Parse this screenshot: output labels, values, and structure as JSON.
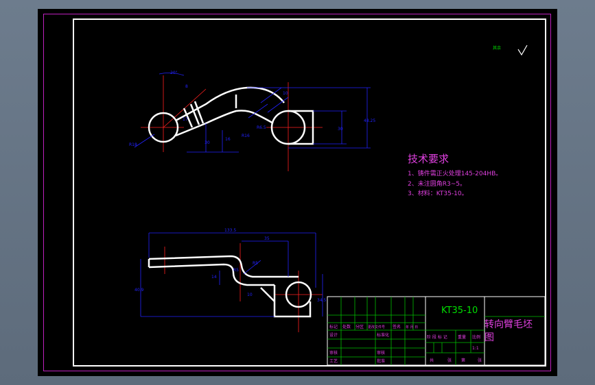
{
  "technical_requirements": {
    "title": "技术要求",
    "items": [
      "1、铸件需正火处理145-204HB。",
      "2、未注圆角R3~5。",
      "3、材料：KT35-10。"
    ]
  },
  "title_block": {
    "drawing_code": "KT35-10",
    "part_name_line1": "转向臂毛坯",
    "part_name_line2": "图",
    "header_labels": [
      "标记",
      "处数",
      "分区",
      "更改文件号",
      "签名",
      "年 月 日"
    ],
    "row_labels": [
      "设计",
      "审核",
      "工艺"
    ],
    "mid_labels": [
      "标准化",
      "审核",
      "批准"
    ],
    "stage_labels": [
      "阶 段 标 记",
      "重量",
      "比例"
    ],
    "scale": "1:1",
    "footer": [
      "共",
      "张",
      "第",
      "张"
    ]
  },
  "dimensions": {
    "top_view": [
      "20°",
      "8",
      "17",
      "R18",
      "10",
      "30",
      "16",
      "R16",
      "R6.5",
      "30",
      "48.25"
    ],
    "front_view": [
      "133.5",
      "35",
      "R5",
      "R5",
      "14",
      "10",
      "40.9",
      "34.5"
    ]
  },
  "surface_finish_symbol": "其余",
  "colors": {
    "background": "#000000",
    "outline": "#ffffff",
    "dimension": "#2222ff",
    "centerline": "#ff2020",
    "text_magenta": "#e040e0",
    "table_green": "#00e000",
    "app_bg": "#6d7c8d"
  }
}
